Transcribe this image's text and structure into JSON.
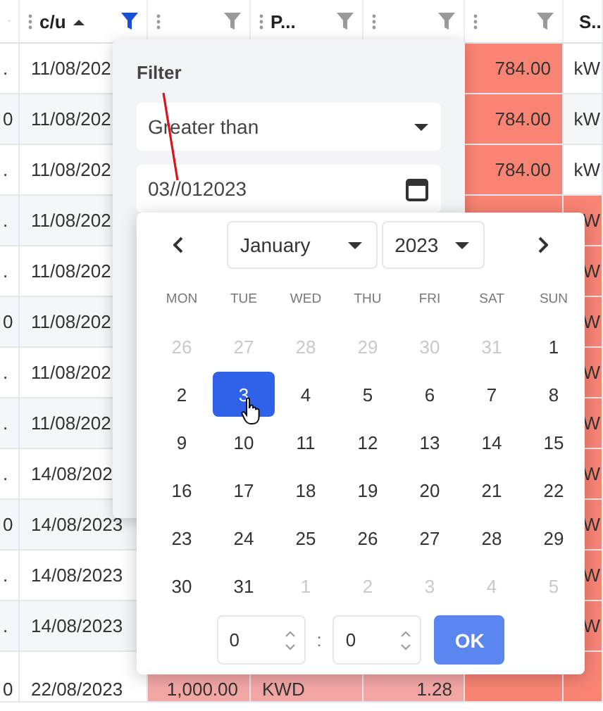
{
  "table": {
    "columns": [
      {
        "filter_active": false
      },
      {
        "label": "c/u",
        "sorted_ascending": true,
        "filter_active": true
      },
      {
        "filter_active": false
      },
      {
        "label": "P...",
        "filter_active": false
      },
      {
        "filter_active": false
      },
      {
        "filter_active": false
      },
      {
        "label": "S.."
      }
    ],
    "rows": [
      [
        {
          "text": "."
        },
        {
          "text": "11/08/202"
        },
        {},
        {},
        {},
        {
          "text": "784.00",
          "color": "#f98474"
        },
        {
          "text": "kW"
        }
      ],
      [
        {
          "text": "0"
        },
        {
          "text": "11/08/202"
        },
        {},
        {},
        {},
        {
          "text": "784.00",
          "color": "#f98474"
        },
        {
          "text": "kW"
        }
      ],
      [
        {
          "text": "."
        },
        {
          "text": "11/08/202"
        },
        {},
        {},
        {},
        {
          "text": "784.00",
          "color": "#f98474"
        },
        {
          "text": "kW"
        }
      ],
      [
        {
          "text": "."
        },
        {
          "text": "11/08/202"
        },
        {},
        {},
        {},
        {
          "color": "#f98474"
        },
        {
          "text": "W",
          "color": "#f98474"
        }
      ],
      [
        {
          "text": "."
        },
        {
          "text": "11/08/202"
        },
        {},
        {},
        {},
        {},
        {
          "text": "W",
          "color": "#f98474"
        }
      ],
      [
        {
          "text": "0"
        },
        {
          "text": "11/08/202"
        },
        {},
        {},
        {},
        {},
        {
          "text": "W",
          "color": "#f98474"
        }
      ],
      [
        {
          "text": "."
        },
        {
          "text": "11/08/202"
        },
        {},
        {},
        {},
        {},
        {
          "text": "W",
          "color": "#f98474"
        }
      ],
      [
        {
          "text": "."
        },
        {
          "text": "11/08/202"
        },
        {},
        {},
        {},
        {},
        {
          "text": "W",
          "color": "#f98474"
        }
      ],
      [
        {
          "text": "."
        },
        {
          "text": "14/08/202"
        },
        {},
        {},
        {},
        {},
        {
          "text": "W",
          "color": "#f98474"
        }
      ],
      [
        {
          "text": "0"
        },
        {
          "text": "14/08/2023"
        },
        {},
        {},
        {},
        {},
        {
          "text": "W",
          "color": "#f98474"
        }
      ],
      [
        {
          "text": "."
        },
        {
          "text": "14/08/2023"
        },
        {},
        {},
        {},
        {},
        {
          "text": "W",
          "color": "#f98474"
        }
      ],
      [
        {
          "text": "."
        },
        {
          "text": "14/08/2023"
        },
        {},
        {},
        {},
        {},
        {
          "text": "W",
          "color": "#f98474"
        }
      ],
      [
        {
          "text": "0"
        },
        {
          "text": "22/08/2023"
        },
        {
          "text": "1,000.00",
          "color": "#f3a7a5"
        },
        {
          "text": "KWD",
          "color": "#f3a7a5"
        },
        {
          "text": "1.28",
          "color": "#f3a7a5"
        },
        {
          "color": "#f98474"
        },
        {
          "color": "#f98474"
        }
      ]
    ]
  },
  "filter": {
    "title": "Filter",
    "operator": "Greater than",
    "value": "03//012023"
  },
  "calendar": {
    "month": "January",
    "year": "2023",
    "weekdays": [
      "MON",
      "TUE",
      "WED",
      "THU",
      "FRI",
      "SAT",
      "SUN"
    ],
    "weeks": [
      [
        {
          "label": "26",
          "outside": true,
          "selected": false
        },
        {
          "label": "27",
          "outside": true,
          "selected": false
        },
        {
          "label": "28",
          "outside": true,
          "selected": false
        },
        {
          "label": "29",
          "outside": true,
          "selected": false
        },
        {
          "label": "30",
          "outside": true,
          "selected": false
        },
        {
          "label": "31",
          "outside": true,
          "selected": false
        },
        {
          "label": "1",
          "outside": false,
          "selected": false
        }
      ],
      [
        {
          "label": "2",
          "outside": false,
          "selected": false
        },
        {
          "label": "3",
          "outside": false,
          "selected": true
        },
        {
          "label": "4",
          "outside": false,
          "selected": false
        },
        {
          "label": "5",
          "outside": false,
          "selected": false
        },
        {
          "label": "6",
          "outside": false,
          "selected": false
        },
        {
          "label": "7",
          "outside": false,
          "selected": false
        },
        {
          "label": "8",
          "outside": false,
          "selected": false
        }
      ],
      [
        {
          "label": "9",
          "outside": false,
          "selected": false
        },
        {
          "label": "10",
          "outside": false,
          "selected": false
        },
        {
          "label": "11",
          "outside": false,
          "selected": false
        },
        {
          "label": "12",
          "outside": false,
          "selected": false
        },
        {
          "label": "13",
          "outside": false,
          "selected": false
        },
        {
          "label": "14",
          "outside": false,
          "selected": false
        },
        {
          "label": "15",
          "outside": false,
          "selected": false
        }
      ],
      [
        {
          "label": "16",
          "outside": false,
          "selected": false
        },
        {
          "label": "17",
          "outside": false,
          "selected": false
        },
        {
          "label": "18",
          "outside": false,
          "selected": false
        },
        {
          "label": "19",
          "outside": false,
          "selected": false
        },
        {
          "label": "20",
          "outside": false,
          "selected": false
        },
        {
          "label": "21",
          "outside": false,
          "selected": false
        },
        {
          "label": "22",
          "outside": false,
          "selected": false
        }
      ],
      [
        {
          "label": "23",
          "outside": false,
          "selected": false
        },
        {
          "label": "24",
          "outside": false,
          "selected": false
        },
        {
          "label": "25",
          "outside": false,
          "selected": false
        },
        {
          "label": "26",
          "outside": false,
          "selected": false
        },
        {
          "label": "27",
          "outside": false,
          "selected": false
        },
        {
          "label": "28",
          "outside": false,
          "selected": false
        },
        {
          "label": "29",
          "outside": false,
          "selected": false
        }
      ],
      [
        {
          "label": "30",
          "outside": false,
          "selected": false
        },
        {
          "label": "31",
          "outside": false,
          "selected": false
        },
        {
          "label": "1",
          "outside": true,
          "selected": false
        },
        {
          "label": "2",
          "outside": true,
          "selected": false
        },
        {
          "label": "3",
          "outside": true,
          "selected": false
        },
        {
          "label": "4",
          "outside": true,
          "selected": false
        },
        {
          "label": "5",
          "outside": true,
          "selected": false
        }
      ]
    ],
    "hour": "0",
    "separator": ":",
    "minute": "0",
    "ok": "OK"
  }
}
